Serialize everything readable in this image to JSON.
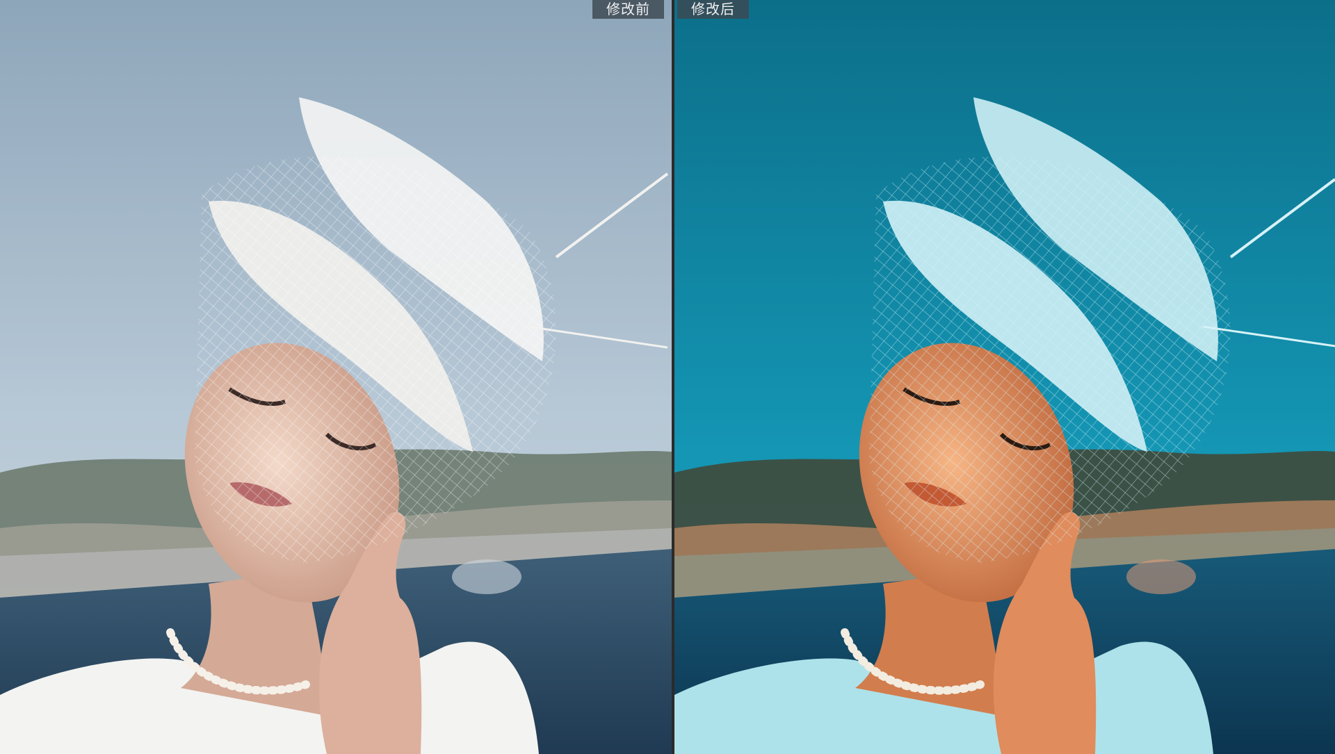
{
  "comparison": {
    "before_label": "修改前",
    "after_label": "修改后"
  },
  "panes": {
    "before": {
      "image": "portrait-woman-veiled-hat-river-natural",
      "colors": {
        "sky_top": "#8fa7bb",
        "sky_bottom": "#c7d4de",
        "water": "#2c4a64",
        "skin": "#e8c6b4",
        "hat": "#eeeeee"
      }
    },
    "after": {
      "image": "portrait-woman-veiled-hat-river-teal-orange",
      "colors": {
        "sky_top": "#0f7f9a",
        "sky_bottom": "#1aa0bf",
        "water": "#124a66",
        "skin": "#f2a06e",
        "hat": "#bfeaf2"
      }
    }
  }
}
